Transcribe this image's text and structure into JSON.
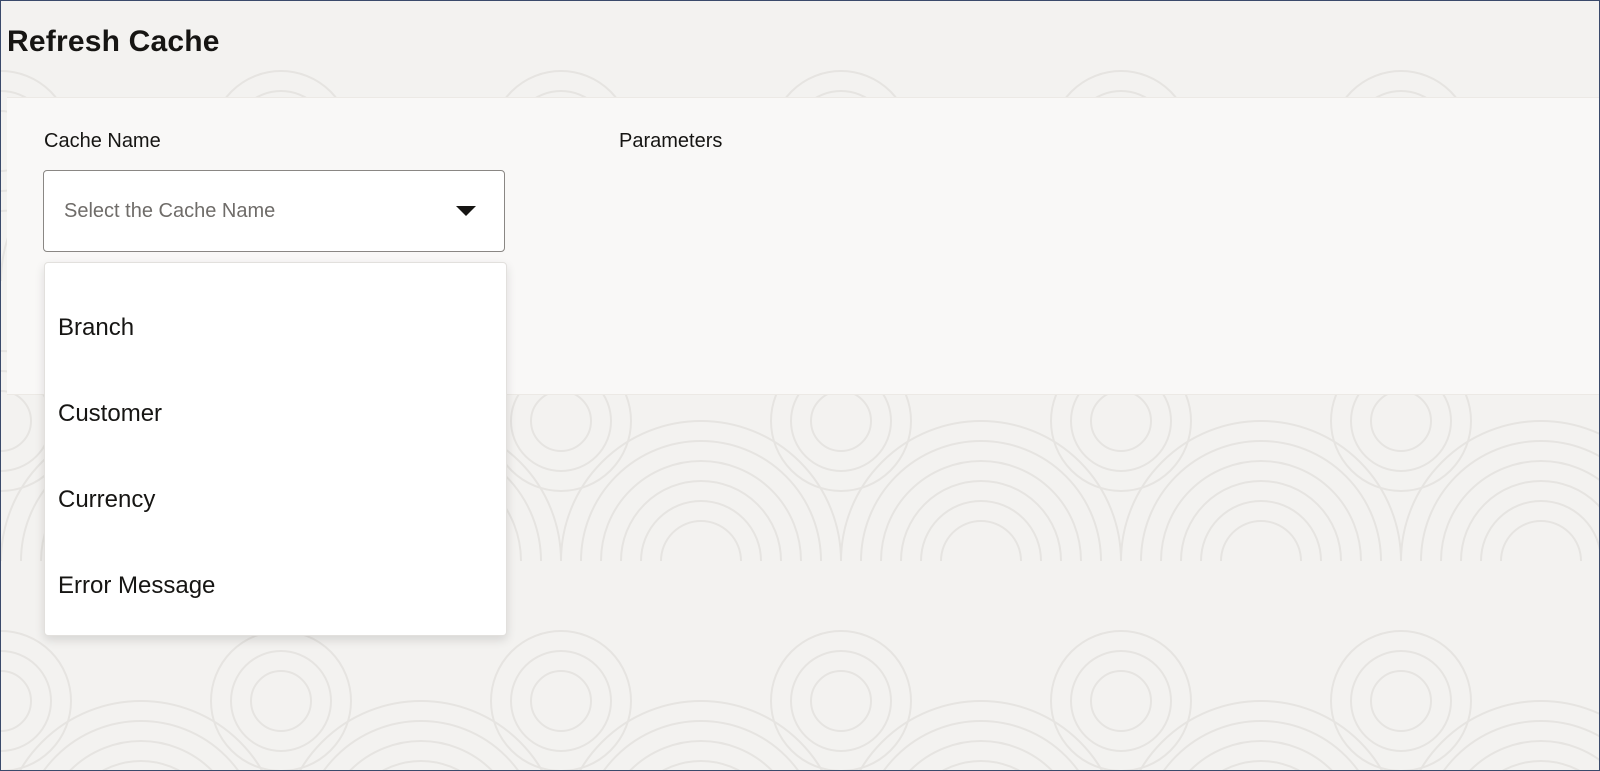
{
  "page": {
    "title": "Refresh Cache"
  },
  "form": {
    "cache_name_label": "Cache Name",
    "cache_name_placeholder": "Select the Cache Name",
    "parameters_label": "Parameters"
  },
  "dropdown": {
    "state": "expanded",
    "options": [
      "Branch",
      "Customer",
      "Currency",
      "Error Message"
    ]
  },
  "icons": {
    "select_chevron": "caret-down-icon"
  },
  "colors": {
    "background": "#f3f2f0",
    "panel": "#f9f8f7",
    "frame_border": "#3a4a6b",
    "text": "#161513",
    "placeholder": "#6f6c69"
  }
}
